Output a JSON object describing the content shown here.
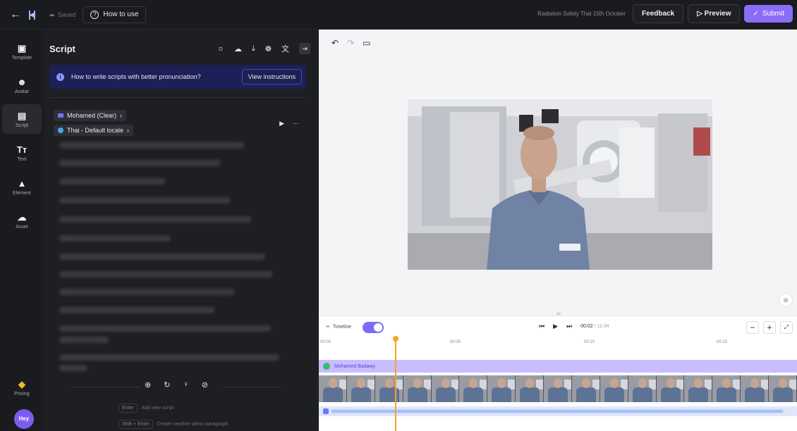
{
  "topbar": {
    "back_icon": "arrow-left-icon",
    "logo_icon": "panel-logo-icon",
    "saved_label": "Saved",
    "howto_label": "How to use",
    "project_title": "Radiation Safety Thai 15th October",
    "feedback_label": "Feedback",
    "preview_label": "Preview",
    "submit_label": "Submit",
    "accent_color": "#8a6cf7"
  },
  "rail": {
    "items": [
      {
        "label": "Template",
        "icon": "template-icon"
      },
      {
        "label": "Avatar",
        "icon": "avatar-icon"
      },
      {
        "label": "Script",
        "icon": "script-icon",
        "active": true
      },
      {
        "label": "Text",
        "icon": "text-icon"
      },
      {
        "label": "Element",
        "icon": "shapes-icon"
      },
      {
        "label": "Asset",
        "icon": "cloud-upload-icon"
      }
    ],
    "pricing_label": "Pricing",
    "avatar_label": "Hey"
  },
  "script": {
    "title": "Script",
    "banner_text": "How to write scripts with better pronunciation?",
    "banner_button": "View instructions",
    "voice_label": "Mohamed (Clear)",
    "locale_label": "Thai - Default locale",
    "hint_enter_key": "Enter",
    "hint_enter_text": "Add new script",
    "hint_shift_key": "Shift + Enter",
    "hint_shift_text": "Create newline within paragraph"
  },
  "timeline": {
    "toggle_label": "Timeline",
    "time_current": "00:02",
    "time_total": "/ 11:34",
    "track_name": "Mohamed Badawy",
    "ruler_marks": [
      "00:00",
      "00:05",
      "00:10",
      "00:15"
    ]
  }
}
